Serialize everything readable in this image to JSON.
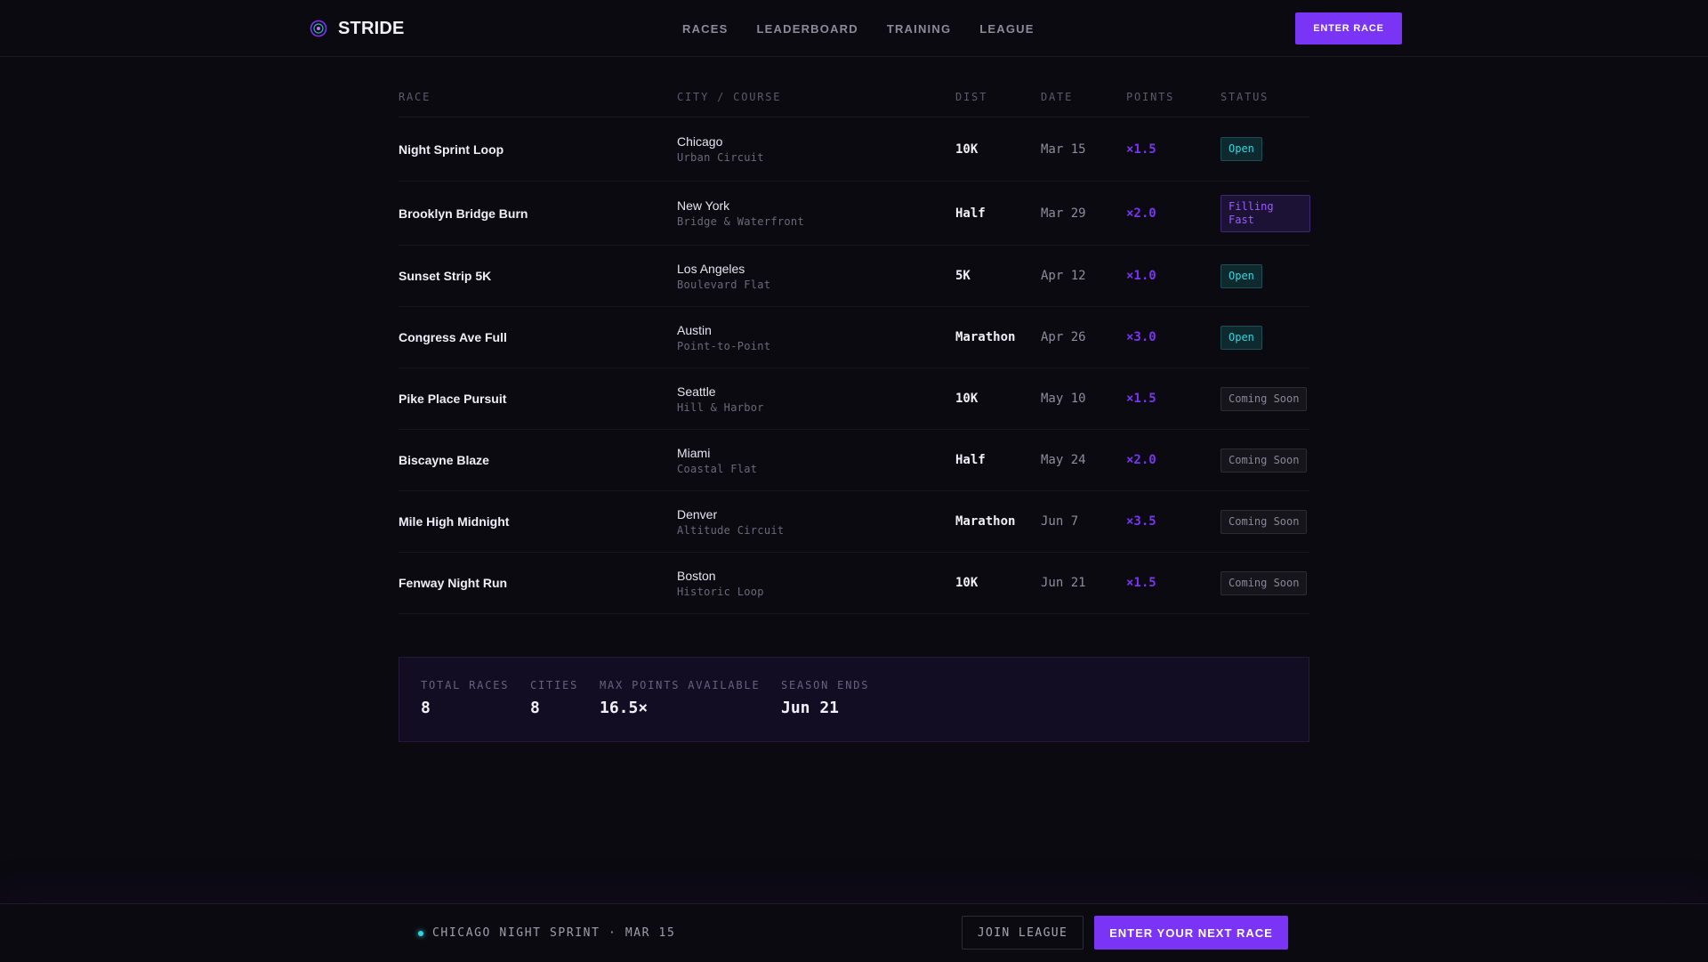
{
  "header": {
    "brand": "STRIDE",
    "nav": [
      "RACES",
      "LEADERBOARD",
      "TRAINING",
      "LEAGUE"
    ],
    "cta": "ENTER RACE"
  },
  "table": {
    "columns": {
      "race": "RACE",
      "city": "CITY / COURSE",
      "dist": "DIST",
      "date": "DATE",
      "points": "POINTS",
      "status": "STATUS"
    },
    "rows": [
      {
        "race": "Night Sprint Loop",
        "city": "Chicago",
        "course": "Urban Circuit",
        "dist": "10K",
        "date": "Mar 15",
        "points": "×1.5",
        "status": "Open",
        "status_type": "open"
      },
      {
        "race": "Brooklyn Bridge Burn",
        "city": "New York",
        "course": "Bridge & Waterfront",
        "dist": "Half",
        "date": "Mar 29",
        "points": "×2.0",
        "status": "Filling Fast",
        "status_type": "fast"
      },
      {
        "race": "Sunset Strip 5K",
        "city": "Los Angeles",
        "course": "Boulevard Flat",
        "dist": "5K",
        "date": "Apr 12",
        "points": "×1.0",
        "status": "Open",
        "status_type": "open"
      },
      {
        "race": "Congress Ave Full",
        "city": "Austin",
        "course": "Point-to-Point",
        "dist": "Marathon",
        "date": "Apr 26",
        "points": "×3.0",
        "status": "Open",
        "status_type": "open"
      },
      {
        "race": "Pike Place Pursuit",
        "city": "Seattle",
        "course": "Hill & Harbor",
        "dist": "10K",
        "date": "May 10",
        "points": "×1.5",
        "status": "Coming Soon",
        "status_type": "soon"
      },
      {
        "race": "Biscayne Blaze",
        "city": "Miami",
        "course": "Coastal Flat",
        "dist": "Half",
        "date": "May 24",
        "points": "×2.0",
        "status": "Coming Soon",
        "status_type": "soon"
      },
      {
        "race": "Mile High Midnight",
        "city": "Denver",
        "course": "Altitude Circuit",
        "dist": "Marathon",
        "date": "Jun 7",
        "points": "×3.5",
        "status": "Coming Soon",
        "status_type": "soon"
      },
      {
        "race": "Fenway Night Run",
        "city": "Boston",
        "course": "Historic Loop",
        "dist": "10K",
        "date": "Jun 21",
        "points": "×1.5",
        "status": "Coming Soon",
        "status_type": "soon"
      }
    ]
  },
  "stats": [
    {
      "label": "TOTAL RACES",
      "value": "8"
    },
    {
      "label": "CITIES",
      "value": "8"
    },
    {
      "label": "MAX POINTS AVAILABLE",
      "value": "16.5×"
    },
    {
      "label": "SEASON ENDS",
      "value": "Jun 21"
    }
  ],
  "footer": {
    "live_text": "CHICAGO NIGHT SPRINT · MAR 15",
    "join": "JOIN LEAGUE",
    "enter": "ENTER YOUR NEXT RACE"
  },
  "colors": {
    "accent": "#7a34f5",
    "open": "#2fd6e0",
    "background": "#0b0a10"
  }
}
